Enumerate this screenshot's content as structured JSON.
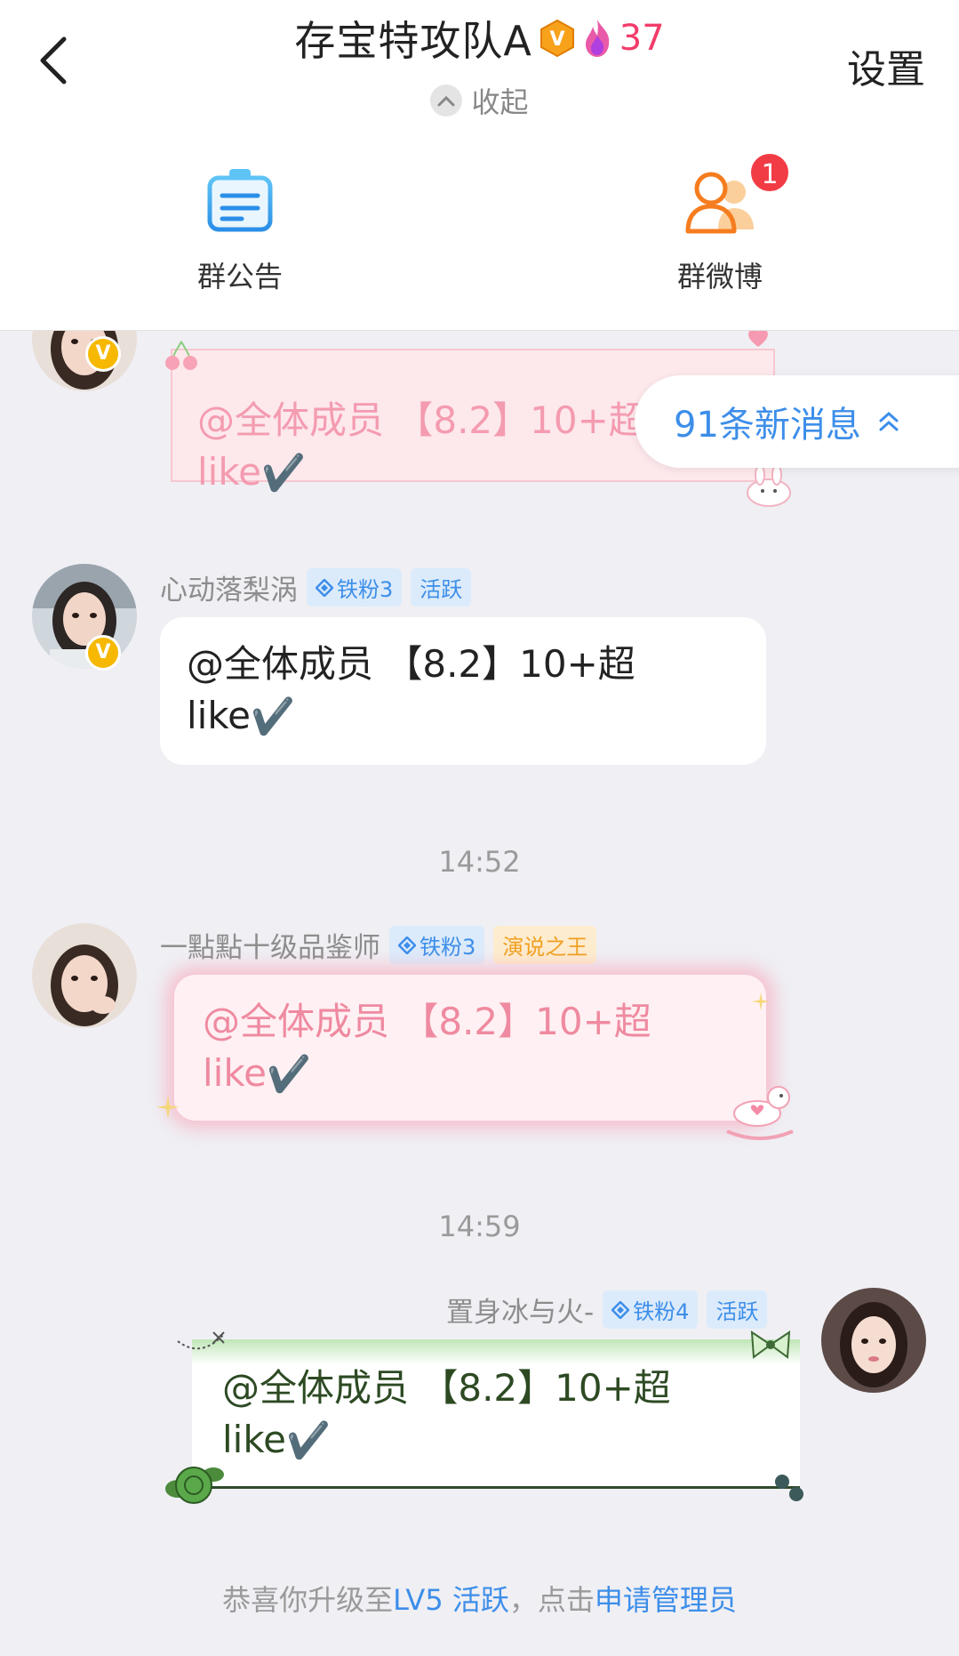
{
  "header": {
    "title": "存宝特攻队A",
    "fire_count": "37",
    "settings": "设置",
    "collapse": "收起"
  },
  "shortcuts": {
    "notice_label": "群公告",
    "weibo_label": "群微博",
    "weibo_badge": "1"
  },
  "new_messages": "91条新消息",
  "messages": [
    {
      "sender": "",
      "text": "@全体成员 【8.2】10+超",
      "text2": "like",
      "check": "✔️"
    },
    {
      "sender": "心动落梨涡",
      "fan_tag": "铁粉3",
      "extra_tag": "活跃",
      "text": "@全体成员 【8.2】10+超",
      "text2": "like",
      "check": "✔️"
    },
    {
      "sender": "一點點十级品鉴师",
      "fan_tag": "铁粉3",
      "extra_tag": "演说之王",
      "text": "@全体成员 【8.2】10+超",
      "text2": "like",
      "check": "✔️"
    },
    {
      "sender": "置身冰与火-",
      "fan_tag": "铁粉4",
      "extra_tag": "活跃",
      "text": "@全体成员 【8.2】10+超",
      "text2": "like",
      "check": "✔️"
    }
  ],
  "times": [
    "14:52",
    "14:59"
  ],
  "footer": {
    "prefix": "恭喜你升级至",
    "level": "LV5 活跃",
    "middle": "，点击",
    "link": "申请管理员"
  },
  "colors": {
    "accent_blue": "#3d8ee9",
    "fire_red": "#f23c6a",
    "badge_red": "#f23c45",
    "vip_orange": "#f6b800"
  }
}
